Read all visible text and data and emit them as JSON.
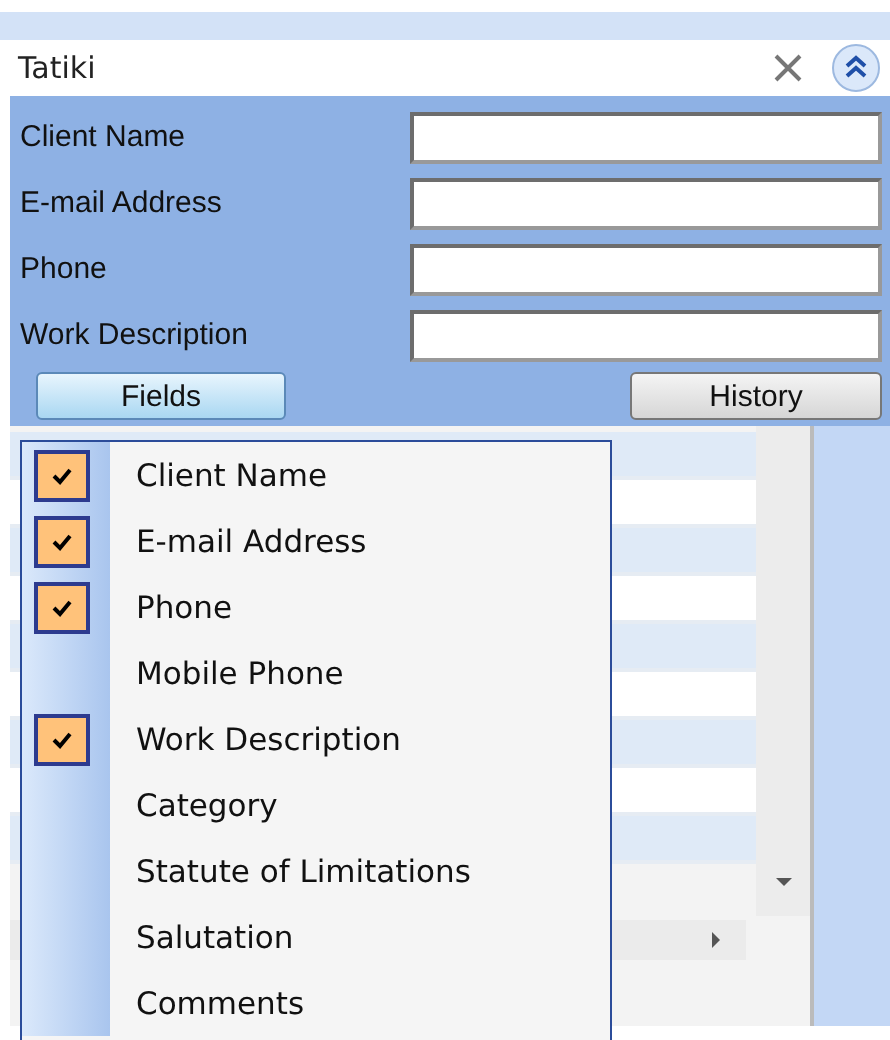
{
  "window": {
    "title": "Tatiki"
  },
  "form_fields": [
    {
      "label": "Client Name"
    },
    {
      "label": "E-mail Address"
    },
    {
      "label": "Phone"
    },
    {
      "label": "Work Description"
    }
  ],
  "buttons": [
    {
      "label": "Fields",
      "pressed": true
    },
    {
      "label": "History",
      "pressed": false
    }
  ],
  "fields_menu": [
    {
      "label": "Client Name",
      "checked": true
    },
    {
      "label": "E-mail Address",
      "checked": true
    },
    {
      "label": "Phone",
      "checked": true
    },
    {
      "label": "Mobile Phone",
      "checked": false
    },
    {
      "label": "Work Description",
      "checked": true
    },
    {
      "label": "Category",
      "checked": false
    },
    {
      "label": "Statute of Limitations",
      "checked": false
    },
    {
      "label": "Salutation",
      "checked": false
    },
    {
      "label": "Comments",
      "checked": false
    }
  ]
}
